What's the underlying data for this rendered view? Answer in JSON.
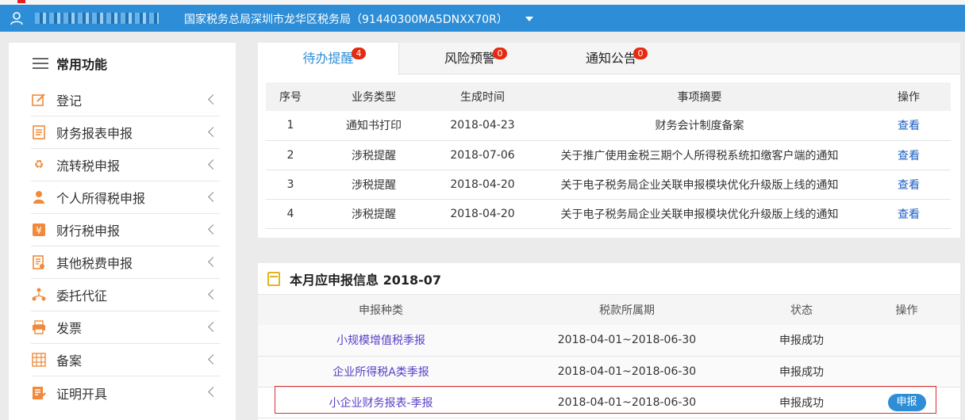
{
  "topbar": {
    "org_title": "国家税务总局深圳市龙华区税务局（91440300MA5DNXX70R）"
  },
  "sidebar": {
    "title": "常用功能",
    "items": [
      {
        "label": "登记",
        "icon": "edit-icon"
      },
      {
        "label": "财务报表申报",
        "icon": "document-icon"
      },
      {
        "label": "流转税申报",
        "icon": "recycle-icon"
      },
      {
        "label": "个人所得税申报",
        "icon": "person-icon"
      },
      {
        "label": "财行税申报",
        "icon": "yuan-icon"
      },
      {
        "label": "其他税费申报",
        "icon": "form-icon"
      },
      {
        "label": "委托代征",
        "icon": "people-network-icon"
      },
      {
        "label": "发票",
        "icon": "printer-icon"
      },
      {
        "label": "备案",
        "icon": "grid-icon"
      },
      {
        "label": "证明开具",
        "icon": "certificate-icon"
      }
    ]
  },
  "tabs": [
    {
      "label": "待办提醒",
      "badge": "4"
    },
    {
      "label": "风险预警",
      "badge": "0"
    },
    {
      "label": "通知公告",
      "badge": "0"
    }
  ],
  "todo_table": {
    "headers": [
      "序号",
      "业务类型",
      "生成时间",
      "事项摘要",
      "操作"
    ],
    "rows": [
      {
        "no": "1",
        "type": "通知书打印",
        "date": "2018-04-23",
        "summary": "财务会计制度备案",
        "action": "查看"
      },
      {
        "no": "2",
        "type": "涉税提醒",
        "date": "2018-07-06",
        "summary": "关于推广使用金税三期个人所得税系统扣缴客户端的通知",
        "action": "查看"
      },
      {
        "no": "3",
        "type": "涉税提醒",
        "date": "2018-04-20",
        "summary": "关于电子税务局企业关联申报模块优化升级版上线的通知",
        "action": "查看"
      },
      {
        "no": "4",
        "type": "涉税提醒",
        "date": "2018-04-20",
        "summary": "关于电子税务局企业关联申报模块优化升级版上线的通知",
        "action": "查看"
      }
    ]
  },
  "monthly": {
    "title": "本月应申报信息  2018-07",
    "headers": [
      "申报种类",
      "税款所属期",
      "状态",
      "操作"
    ],
    "rows": [
      {
        "kind": "小规模增值税季报",
        "period": "2018-04-01~2018-06-30",
        "status": "申报成功",
        "action": ""
      },
      {
        "kind": "企业所得税A类季报",
        "period": "2018-04-01~2018-06-30",
        "status": "申报成功",
        "action": ""
      },
      {
        "kind": "小企业财务报表-季报",
        "period": "2018-04-01~2018-06-30",
        "status": "申报成功",
        "action": "申报"
      }
    ]
  },
  "colors": {
    "accent": "#2d8ed7",
    "badge": "#e6290f",
    "link": "#1d5fc6"
  }
}
